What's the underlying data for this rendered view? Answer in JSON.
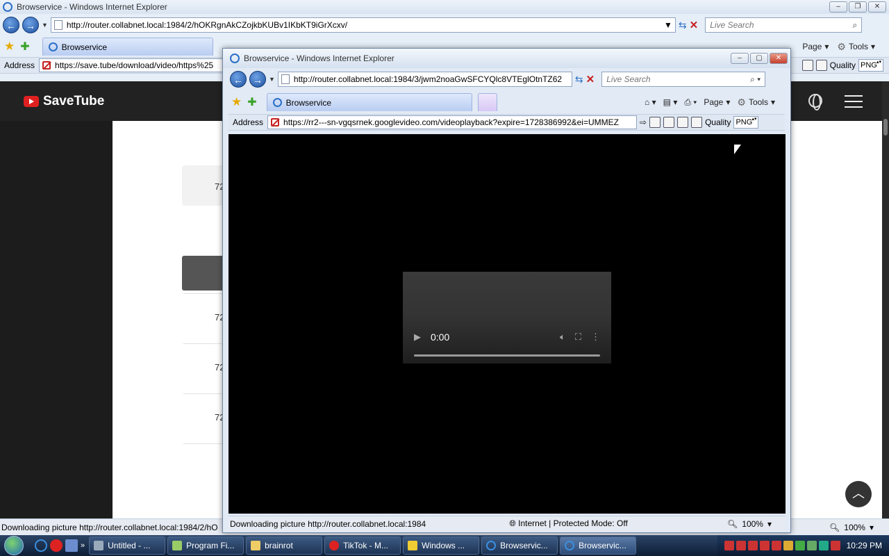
{
  "main_window": {
    "title": "Browservice - Windows Internet Explorer",
    "url": "http://router.collabnet.local:1984/2/hOKRgnAkCZojkbKUBv1IKbKT9iGrXcxv/",
    "search_placeholder": "Live Search",
    "tab_label": "Browservice",
    "address_label": "Address",
    "address_value": "https://save.tube/download/video/https%25",
    "quality_label": "Quality",
    "quality_value": "PNG",
    "page_menu": "Page",
    "tools_menu": "Tools",
    "status_text": "Downloading picture http://router.collabnet.local:1984/2/hO",
    "zoom": "100%"
  },
  "savetube": {
    "logo_text": "SaveTube",
    "card_text": "72",
    "rows": [
      "72",
      "72",
      "72"
    ],
    "scroll_top_icon": "chevron-up-icon"
  },
  "popup": {
    "title": "Browservice - Windows Internet Explorer",
    "url": "http://router.collabnet.local:1984/3/jwm2noaGwSFCYQlc8VTEglOtnTZ62",
    "search_placeholder": "Live Search",
    "tab_label": "Browservice",
    "page_menu": "Page",
    "tools_menu": "Tools",
    "address_label": "Address",
    "address_value": "https://rr2---sn-vgqsrnek.googlevideo.com/videoplayback?expire=1728386992&ei=UMMEZ",
    "quality_label": "Quality",
    "quality_value": "PNG",
    "video_time": "0:00",
    "status_text": "Downloading picture http://router.collabnet.local:1984",
    "zone_text": "Internet | Protected Mode: Off",
    "zoom": "100%"
  },
  "taskbar": {
    "tasks": [
      "Untitled - ...",
      "Program Fi...",
      "brainrot",
      "TikTok - M...",
      "Windows ...",
      "Browservic...",
      "Browservic..."
    ],
    "clock": "10:29 PM"
  }
}
